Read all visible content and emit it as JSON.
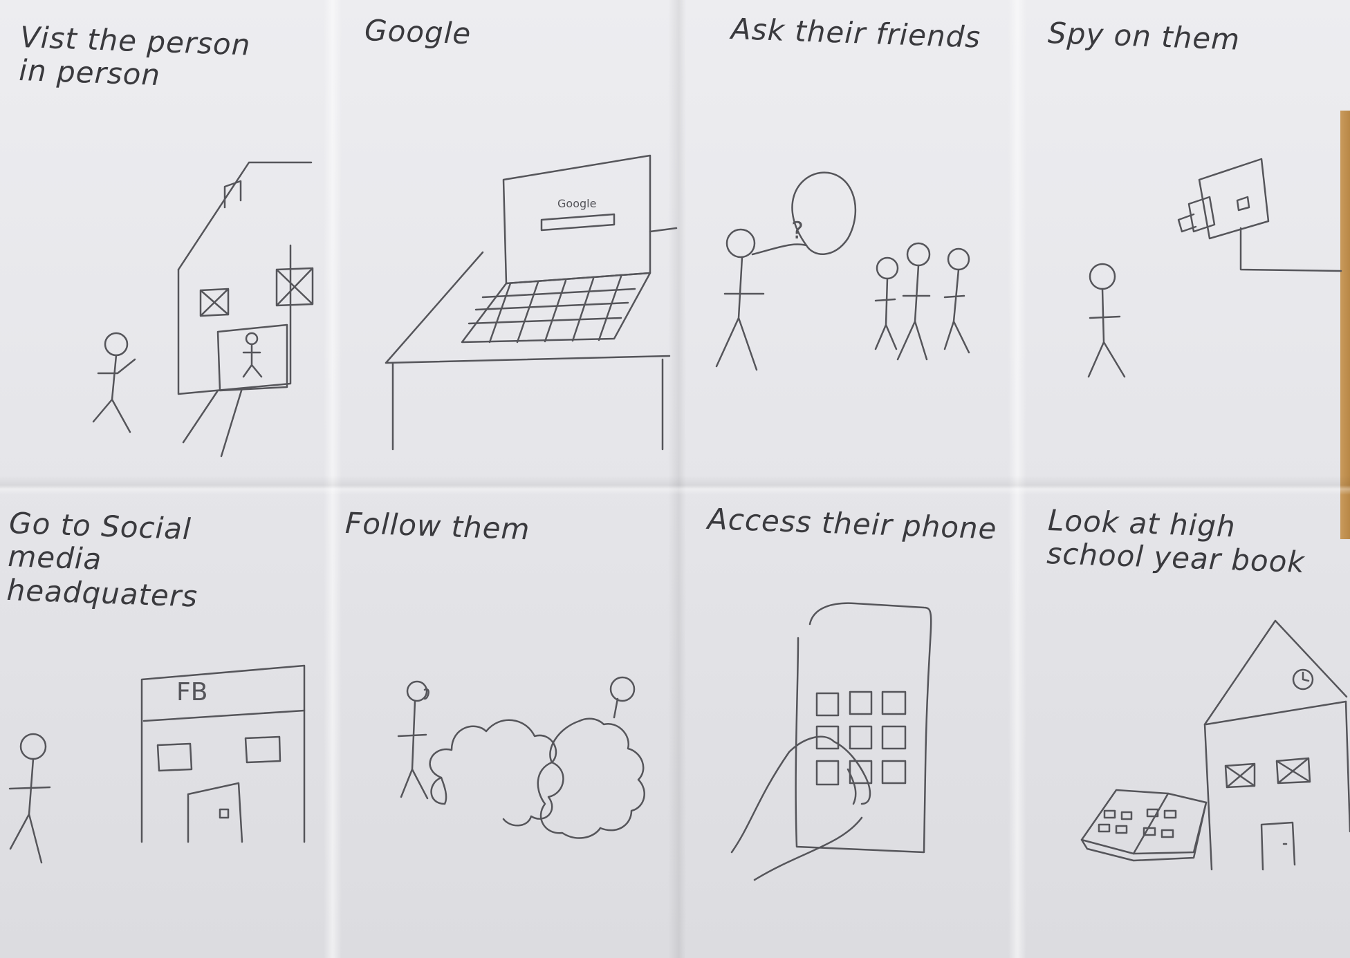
{
  "panels": [
    {
      "id": "visit",
      "caption": "Vist the person in person"
    },
    {
      "id": "google",
      "caption": "Google",
      "screen_text": "Google"
    },
    {
      "id": "friends",
      "caption": "Ask their friends",
      "bubble_text": "?"
    },
    {
      "id": "spy",
      "caption": "Spy on them"
    },
    {
      "id": "social",
      "caption": "Go to Social media headquaters",
      "building_sign": "FB"
    },
    {
      "id": "follow",
      "caption": "Follow them"
    },
    {
      "id": "phone",
      "caption": "Access their phone"
    },
    {
      "id": "yearbook",
      "caption": "Look at high school year book"
    }
  ],
  "colors": {
    "paper": "#e8e8ec",
    "pencil": "#55555a",
    "background_wood": "#b98a4e"
  }
}
